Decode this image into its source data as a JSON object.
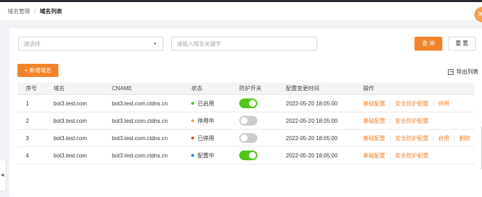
{
  "breadcrumb": {
    "parent": "域名管理",
    "separator": "/",
    "current": "域名列表"
  },
  "filters": {
    "select_placeholder": "请选择",
    "search_placeholder": "请输入域名关键字",
    "query_label": "查 询",
    "reset_label": "重 置"
  },
  "actions": {
    "add_label": "+ 新增域名",
    "export_label": "导出列表"
  },
  "table": {
    "headers": [
      "序号",
      "域名",
      "CNAME",
      "状态",
      "防护开关",
      "配置变更时间",
      "操作"
    ],
    "rows": [
      {
        "index": "1",
        "domain": "bot3.test.com",
        "cname": "bot3.test.com.ctdns.cn",
        "status": "已启用",
        "status_color": "#52c41a",
        "protection_on": true,
        "time": "2022-05-20 18:05:00",
        "ops": [
          "基础配置",
          "安全防护配置",
          "停用"
        ]
      },
      {
        "index": "2",
        "domain": "bot3.test.com",
        "cname": "bot3.test.com.ctdns.cn",
        "status": "停用中",
        "status_color": "#f2a13b",
        "protection_on": false,
        "time": "2022-05-20 18:05:00",
        "ops": [
          "基础配置",
          "安全防护配置"
        ]
      },
      {
        "index": "3",
        "domain": "bot3.test.com",
        "cname": "bot3.test.com.ctdns.cn",
        "status": "已停用",
        "status_color": "#e53935",
        "protection_on": false,
        "time": "2022-05-20 18:05:00",
        "ops": [
          "基础配置",
          "安全防护配置",
          "启用",
          "删除"
        ]
      },
      {
        "index": "4",
        "domain": "bot3.test.com",
        "cname": "bot3.test.com.ctdns.cn",
        "status": "配置中",
        "status_color": "#1e88e5",
        "protection_on": true,
        "time": "2022-05-20 18:05:00",
        "ops": [
          "基础配置",
          "安全防护配置"
        ]
      }
    ]
  },
  "colors": {
    "accent": "#f2832c",
    "toggle_on": "#52c41a",
    "toggle_off": "#cccccc"
  }
}
